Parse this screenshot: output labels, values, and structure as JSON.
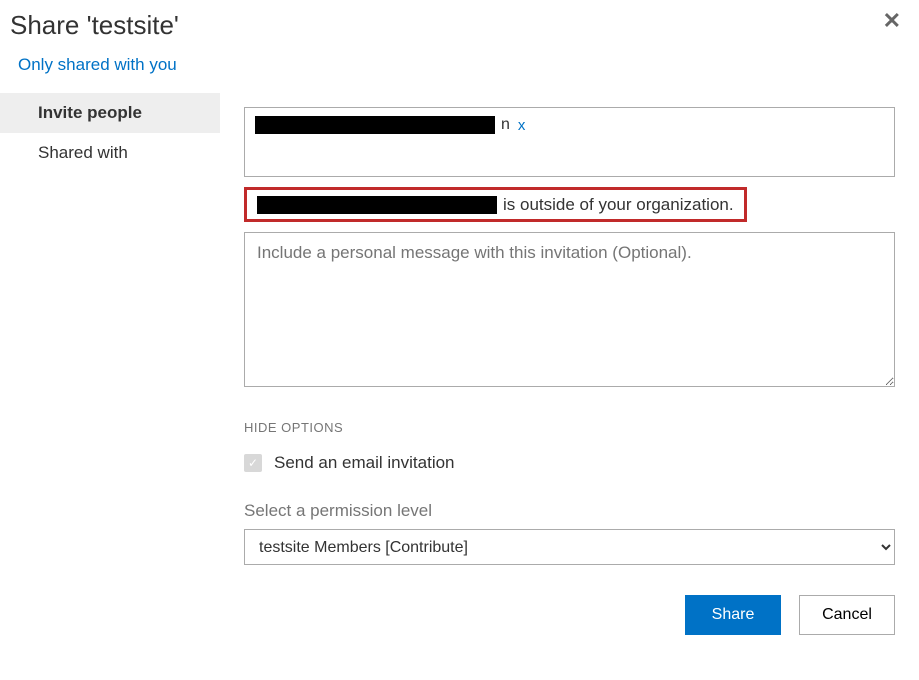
{
  "dialog": {
    "title": "Share 'testsite'"
  },
  "shareStatus": {
    "label": "Only shared with you"
  },
  "sidebar": {
    "items": [
      {
        "label": "Invite people",
        "active": true
      },
      {
        "label": "Shared with",
        "active": false
      }
    ]
  },
  "form": {
    "chip": {
      "suffix": "n",
      "removeGlyph": "x"
    },
    "warning": {
      "text": " is outside of your organization."
    },
    "message": {
      "placeholder": "Include a personal message with this invitation (Optional)."
    },
    "optionsToggle": "HIDE OPTIONS",
    "emailCheckbox": {
      "label": "Send an email invitation",
      "checked": true
    },
    "permission": {
      "label": "Select a permission level",
      "value": "testsite Members [Contribute]"
    },
    "buttons": {
      "share": "Share",
      "cancel": "Cancel"
    }
  }
}
